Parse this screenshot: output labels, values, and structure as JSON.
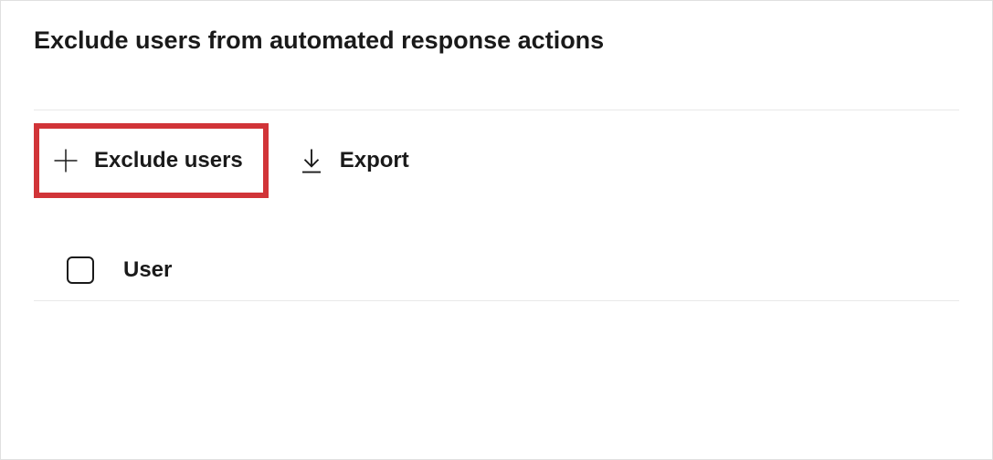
{
  "header": {
    "title": "Exclude users from automated response actions"
  },
  "toolbar": {
    "exclude_users_label": "Exclude users",
    "export_label": "Export"
  },
  "table": {
    "columns": {
      "user": "User"
    }
  },
  "highlight": {
    "color": "#d13438"
  }
}
